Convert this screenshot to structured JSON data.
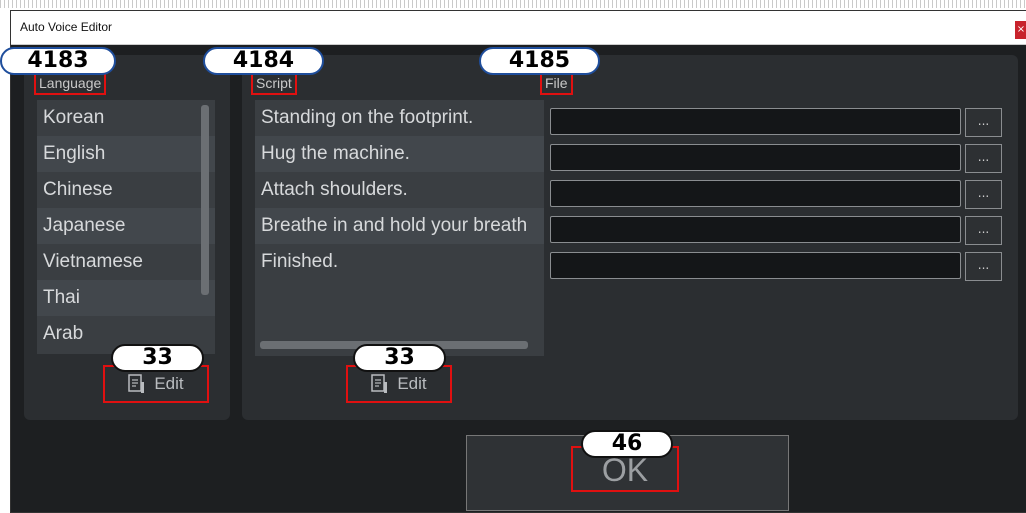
{
  "window": {
    "title": "Auto Voice Editor",
    "close_glyph": "×"
  },
  "language": {
    "header": "Language",
    "items": [
      "Korean",
      "English",
      "Chinese",
      "Japanese",
      "Vietnamese",
      "Thai",
      "Arab"
    ],
    "edit_label": "Edit"
  },
  "script": {
    "header": "Script",
    "items": [
      "Standing on the footprint.",
      "Hug the machine.",
      "Attach shoulders.",
      "Breathe in and hold your breath",
      "Finished."
    ],
    "edit_label": "Edit"
  },
  "file": {
    "header": "File",
    "rows": [
      {
        "value": "",
        "browse": "..."
      },
      {
        "value": "",
        "browse": "..."
      },
      {
        "value": "",
        "browse": "..."
      },
      {
        "value": "",
        "browse": "..."
      },
      {
        "value": "",
        "browse": "..."
      }
    ]
  },
  "ok": {
    "label": "OK"
  },
  "annotations": {
    "language_id": "4183",
    "script_id": "4184",
    "file_id": "4185",
    "edit_left_id": "33",
    "edit_right_id": "33",
    "ok_id": "46"
  },
  "colors": {
    "highlight": "#e01010",
    "badge_border": "#1f4e9c",
    "window_bg": "#1d1f21"
  },
  "icons": [
    "edit-icon",
    "close-icon"
  ]
}
